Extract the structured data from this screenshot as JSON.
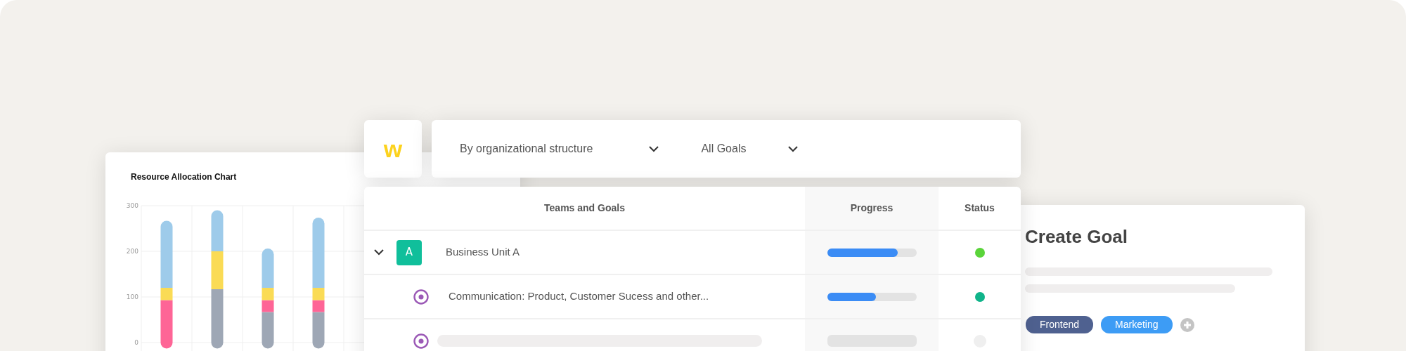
{
  "chart_card": {
    "title": "Resource Allocation Chart",
    "chart_data": {
      "type": "bar",
      "stacked": true,
      "yticks": [
        0,
        100,
        200,
        300
      ],
      "ylim": [
        0,
        300
      ],
      "series": [
        {
          "color": "#9ea7b5",
          "values": [
            0,
            117,
            67,
            67
          ]
        },
        {
          "color": "#fe6596",
          "values": [
            93,
            0,
            26,
            26
          ]
        },
        {
          "color": "#fadb55",
          "values": [
            27,
            83,
            27,
            27
          ]
        },
        {
          "color": "#9ecbea",
          "values": [
            147,
            90,
            86,
            154
          ]
        }
      ]
    }
  },
  "logo": {
    "text": "w"
  },
  "filters": [
    {
      "label": "By organizational structure"
    },
    {
      "label": "All Goals"
    }
  ],
  "table": {
    "columns": [
      "Teams and Goals",
      "Progress",
      "Status"
    ],
    "rows": [
      {
        "kind": "unit",
        "expanded": true,
        "avatar": "A",
        "name": "Business Unit A",
        "level": 0.79,
        "color": "#5ad43a"
      },
      {
        "kind": "goal",
        "name": "Communication: Product, Customer Sucess and other...",
        "level": 0.55,
        "color": "#10b48a"
      },
      {
        "kind": "skeleton"
      }
    ]
  },
  "create_goal": {
    "title": "Create Goal",
    "tags": [
      {
        "label": "Frontend",
        "color": "#4f6190"
      },
      {
        "label": "Marketing",
        "color": "#3d9cf5"
      }
    ]
  }
}
